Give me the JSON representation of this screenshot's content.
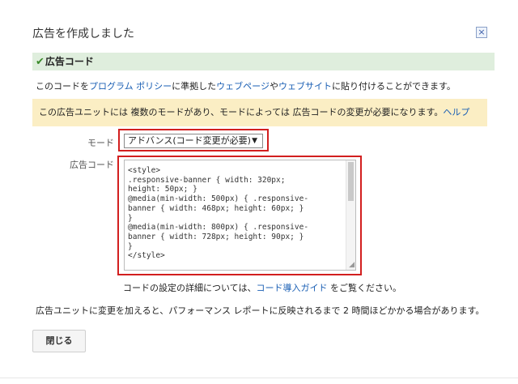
{
  "dialog": {
    "title": "広告を作成しました",
    "close_icon": "×"
  },
  "section": {
    "check_icon": "✔",
    "header": "広告コード"
  },
  "description": {
    "text1": "このコードを",
    "link1": "プログラム ポリシー",
    "text2": "に準拠した",
    "link2": "ウェブページ",
    "text3": "や",
    "link3": "ウェブサイト",
    "text4": "に貼り付けることができます。"
  },
  "notice": {
    "text": "この広告ユニットには 複数のモードがあり、モードによっては 広告コードの変更が必要になります。",
    "help_link": "ヘルプ"
  },
  "mode": {
    "label": "モード",
    "selected": "アドバンス(コード変更が必要)",
    "arrow": "▼"
  },
  "code": {
    "label": "広告コード",
    "text": "<style>\n.responsive-banner { width: 320px;\nheight: 50px; }\n@media(min-width: 500px) { .responsive-\nbanner { width: 468px; height: 60px; }\n}\n@media(min-width: 800px) { .responsive-\nbanner { width: 728px; height: 90px; }\n}\n</style>",
    "resize_glyph": "◢"
  },
  "details": {
    "text1": "コードの設定の詳細については、",
    "link": "コード導入ガイド",
    "text2": " をご覧ください。"
  },
  "footer_note": "広告ユニットに変更を加えると、パフォーマンス レポートに反映されるまで 2 時間ほどかかる場合があります。",
  "buttons": {
    "close": "閉じる"
  }
}
